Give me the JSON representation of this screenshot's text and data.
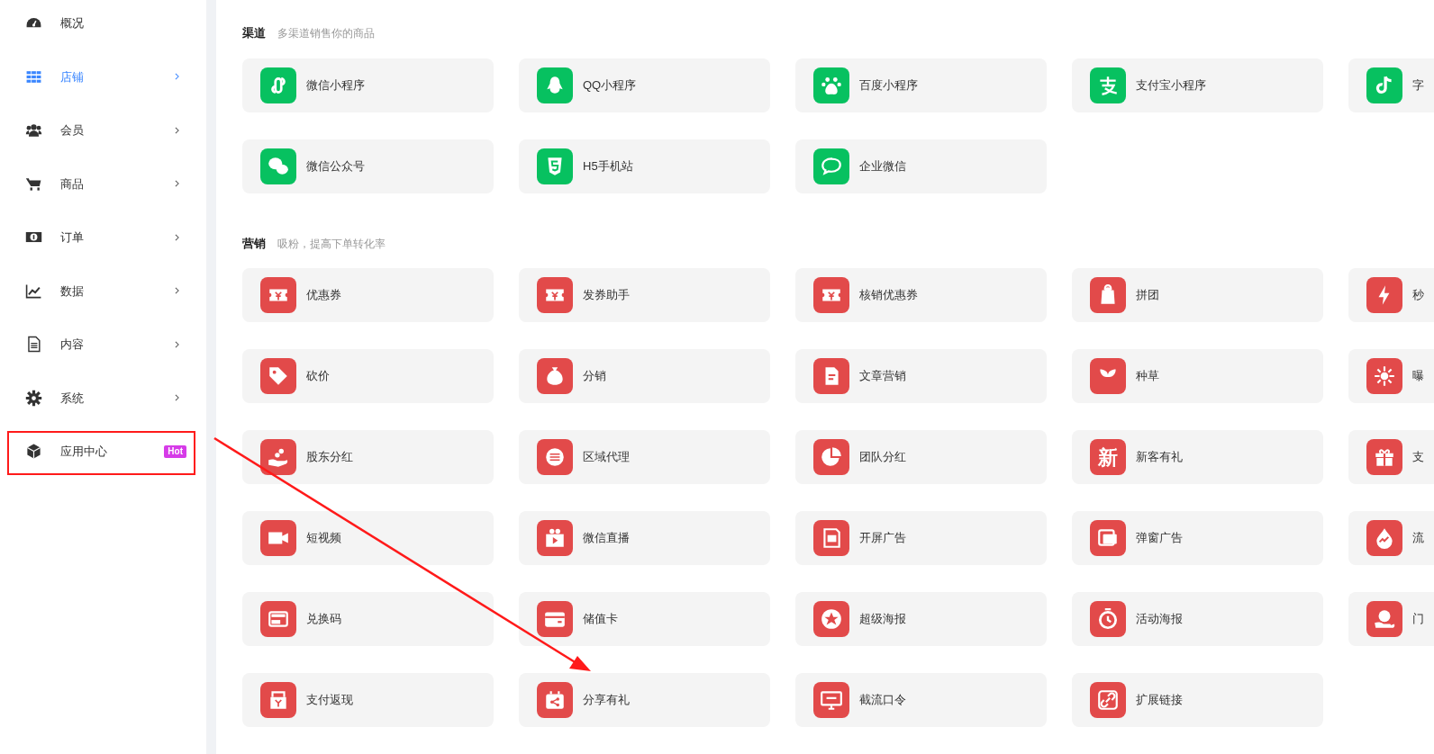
{
  "sidebar": {
    "items": [
      {
        "label": "概况",
        "selected": false,
        "has_submenu": false
      },
      {
        "label": "店铺",
        "selected": true,
        "has_submenu": true
      },
      {
        "label": "会员",
        "selected": false,
        "has_submenu": true
      },
      {
        "label": "商品",
        "selected": false,
        "has_submenu": true
      },
      {
        "label": "订单",
        "selected": false,
        "has_submenu": true
      },
      {
        "label": "数据",
        "selected": false,
        "has_submenu": true
      },
      {
        "label": "内容",
        "selected": false,
        "has_submenu": true
      },
      {
        "label": "系统",
        "selected": false,
        "has_submenu": true
      },
      {
        "label": "应用中心",
        "selected": false,
        "has_submenu": false,
        "badge": "Hot",
        "highlighted": true
      }
    ]
  },
  "sections": [
    {
      "kind": "channel",
      "title": "渠道",
      "subtitle": "多渠道销售你的商品",
      "apps": [
        {
          "label": "微信小程序"
        },
        {
          "label": "QQ小程序"
        },
        {
          "label": "百度小程序"
        },
        {
          "label": "支付宝小程序"
        },
        {
          "label": "字"
        },
        {
          "label": "微信公众号"
        },
        {
          "label": "H5手机站"
        },
        {
          "label": "企业微信"
        }
      ]
    },
    {
      "kind": "marketing",
      "title": "营销",
      "subtitle": "吸粉，提高下单转化率",
      "apps": [
        {
          "label": "优惠券"
        },
        {
          "label": "发券助手"
        },
        {
          "label": "核销优惠券"
        },
        {
          "label": "拼团"
        },
        {
          "label": "秒"
        },
        {
          "label": "砍价"
        },
        {
          "label": "分销"
        },
        {
          "label": "文章营销"
        },
        {
          "label": "种草"
        },
        {
          "label": "曝"
        },
        {
          "label": "股东分红"
        },
        {
          "label": "区域代理"
        },
        {
          "label": "团队分红"
        },
        {
          "label": "新客有礼",
          "icon_text": "新"
        },
        {
          "label": "支"
        },
        {
          "label": "短视频"
        },
        {
          "label": "微信直播"
        },
        {
          "label": "开屏广告"
        },
        {
          "label": "弹窗广告"
        },
        {
          "label": "流"
        },
        {
          "label": "兑换码"
        },
        {
          "label": "储值卡"
        },
        {
          "label": "超级海报"
        },
        {
          "label": "活动海报"
        },
        {
          "label": "门"
        },
        {
          "label": "支付返现"
        },
        {
          "label": "分享有礼"
        },
        {
          "label": "截流口令"
        },
        {
          "label": "扩展链接"
        }
      ]
    }
  ],
  "arrow_annotation": true
}
